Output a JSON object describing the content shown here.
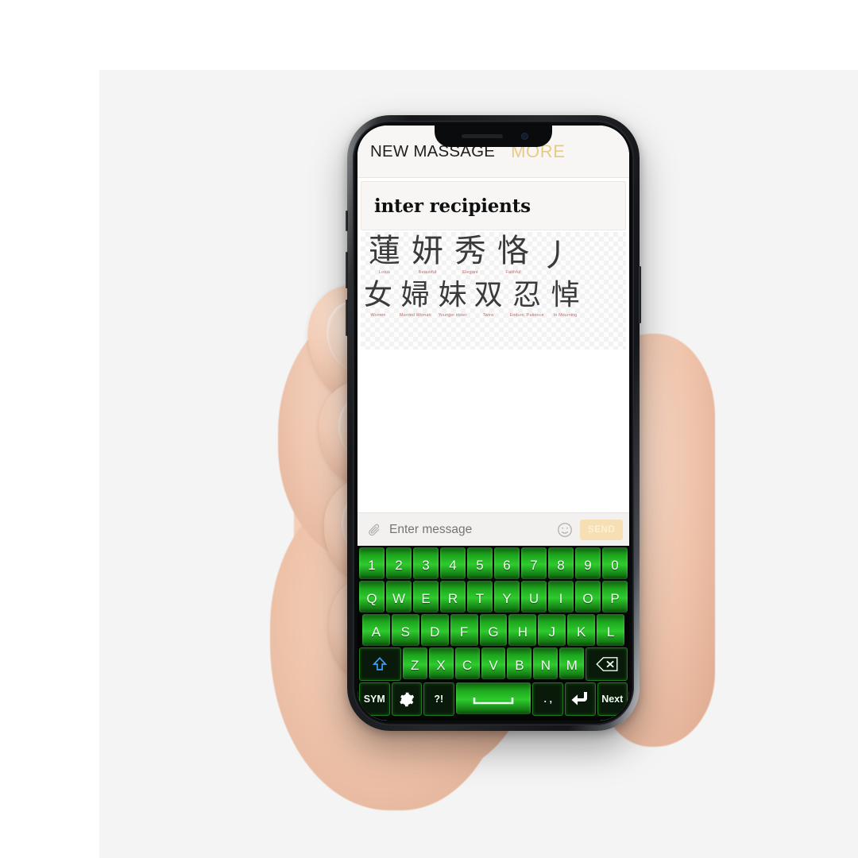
{
  "app": {
    "header": {
      "title": "NEW MASSAGE",
      "more_label": "MORE"
    },
    "recipients_field": {
      "value": "inter recipients",
      "placeholder": "inter recipients"
    },
    "character_picker": {
      "rows": [
        {
          "cells": [
            {
              "glyph": "蓮",
              "gloss": "Lotus"
            },
            {
              "glyph": "妍",
              "gloss": "Beautiful"
            },
            {
              "glyph": "秀",
              "gloss": "Elegant"
            },
            {
              "glyph": "恪",
              "gloss": "Faithful"
            },
            {
              "glyph": "丿",
              "gloss": ""
            }
          ]
        },
        {
          "cells": [
            {
              "glyph": "女",
              "gloss": "Women"
            },
            {
              "glyph": "婦",
              "gloss": "Married Woman"
            },
            {
              "glyph": "妹",
              "gloss": "Younger sister"
            },
            {
              "glyph": "双",
              "gloss": "Twins"
            },
            {
              "glyph": "忍",
              "gloss": "Endure, Patience"
            },
            {
              "glyph": "悼",
              "gloss": "In Mourning"
            }
          ]
        }
      ]
    },
    "message_bar": {
      "attach_icon": "paperclip-icon",
      "placeholder": "Enter message",
      "value": "",
      "emoji_icon": "smiley-icon",
      "send_label": "SEND"
    },
    "keyboard": {
      "rows": [
        {
          "keys": [
            {
              "label": "1",
              "name": "key-1"
            },
            {
              "label": "2",
              "name": "key-2"
            },
            {
              "label": "3",
              "name": "key-3"
            },
            {
              "label": "4",
              "name": "key-4"
            },
            {
              "label": "5",
              "name": "key-5"
            },
            {
              "label": "6",
              "name": "key-6"
            },
            {
              "label": "7",
              "name": "key-7"
            },
            {
              "label": "8",
              "name": "key-8"
            },
            {
              "label": "9",
              "name": "key-9"
            },
            {
              "label": "0",
              "name": "key-0"
            }
          ]
        },
        {
          "keys": [
            {
              "label": "Q",
              "name": "key-q"
            },
            {
              "label": "W",
              "name": "key-w"
            },
            {
              "label": "E",
              "name": "key-e"
            },
            {
              "label": "R",
              "name": "key-r"
            },
            {
              "label": "T",
              "name": "key-t"
            },
            {
              "label": "Y",
              "name": "key-y"
            },
            {
              "label": "U",
              "name": "key-u"
            },
            {
              "label": "I",
              "name": "key-i"
            },
            {
              "label": "O",
              "name": "key-o"
            },
            {
              "label": "P",
              "name": "key-p"
            }
          ]
        },
        {
          "keys": [
            {
              "label": "A",
              "name": "key-a"
            },
            {
              "label": "S",
              "name": "key-s"
            },
            {
              "label": "D",
              "name": "key-d"
            },
            {
              "label": "F",
              "name": "key-f"
            },
            {
              "label": "G",
              "name": "key-g"
            },
            {
              "label": "H",
              "name": "key-h"
            },
            {
              "label": "J",
              "name": "key-j"
            },
            {
              "label": "K",
              "name": "key-k"
            },
            {
              "label": "L",
              "name": "key-l"
            }
          ]
        },
        {
          "keys": [
            {
              "label": "",
              "name": "shift-key",
              "icon": "shift-arrow-icon"
            },
            {
              "label": "Z",
              "name": "key-z"
            },
            {
              "label": "X",
              "name": "key-x"
            },
            {
              "label": "C",
              "name": "key-c"
            },
            {
              "label": "V",
              "name": "key-v"
            },
            {
              "label": "B",
              "name": "key-b"
            },
            {
              "label": "N",
              "name": "key-n"
            },
            {
              "label": "M",
              "name": "key-m"
            },
            {
              "label": "",
              "name": "backspace-key",
              "icon": "backspace-icon"
            }
          ]
        },
        {
          "keys": [
            {
              "label": "SYM",
              "name": "symbols-key"
            },
            {
              "label": "",
              "name": "settings-key",
              "icon": "gear-icon"
            },
            {
              "label": "?!",
              "name": "punctuation-key"
            },
            {
              "label": "",
              "name": "space-key",
              "icon": "space-icon"
            },
            {
              "label": ". ,",
              "name": "period-comma-key"
            },
            {
              "label": "",
              "name": "enter-key",
              "icon": "enter-arrow-icon"
            },
            {
              "label": "Next",
              "name": "next-key"
            }
          ]
        }
      ]
    }
  },
  "colors": {
    "accent_gold": "#e9c988",
    "send_bg": "#f7dfb4",
    "key_green": "#2ecb2e",
    "gloss_red": "#c96a6a",
    "backdrop": "#f4f4f4"
  }
}
